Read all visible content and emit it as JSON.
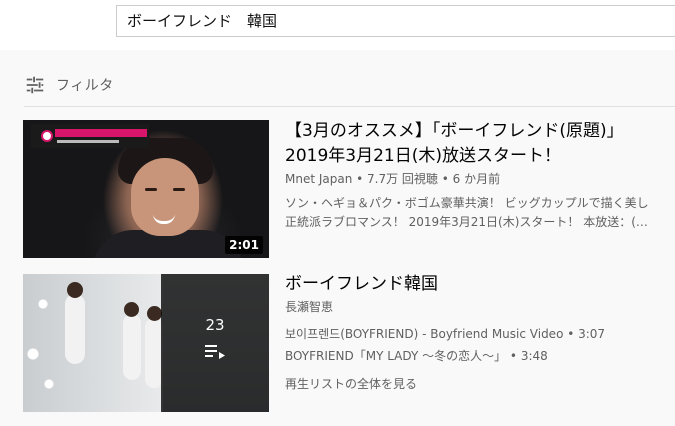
{
  "search": {
    "query": "ボーイフレンド　韓国"
  },
  "filter": {
    "label": "フィルタ"
  },
  "results": [
    {
      "title_line1": "【3月のオススメ】「ボーイフレンド(原題)」",
      "title_line2": "2019年3月21日(木)放送スタート！",
      "meta": "Mnet Japan • 7.7万 回視聴 • 6 か月前",
      "desc_line1": "ソン・ヘギョ＆パク・ボゴム豪華共演！ ビッグカップルで描く美し",
      "desc_line2": "正統派ラブロマンス！ 2019年3月21日(木)スタート！ 本放送：(…",
      "duration": "2:01"
    },
    {
      "title": "ボーイフレンド韓国",
      "channel": "長瀬智恵",
      "playlist_count": "23",
      "items": [
        "보이프렌드(BOYFRIEND) - Boyfriend Music Video • 3:07",
        "BOYFRIEND「MY LADY 〜冬の恋人〜」 • 3:48"
      ],
      "view_full": "再生リストの全体を見る"
    }
  ]
}
